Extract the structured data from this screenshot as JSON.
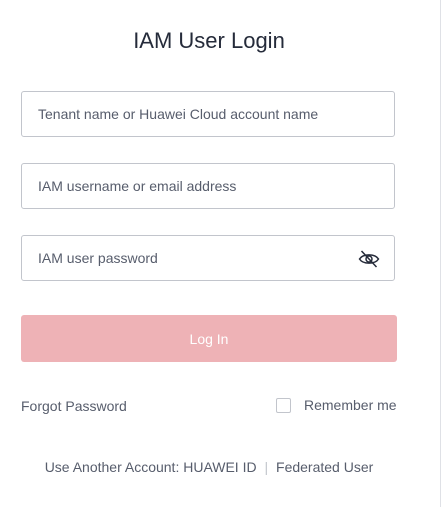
{
  "form": {
    "title": "IAM User Login",
    "tenant_field": {
      "value": "",
      "placeholder": "Tenant name or Huawei Cloud account name"
    },
    "username_field": {
      "value": "",
      "placeholder": "IAM username or email address"
    },
    "password_field": {
      "value": "",
      "placeholder": "IAM user password",
      "toggle_icon": "eye-hidden-icon"
    },
    "login_button": {
      "label": "Log In",
      "state": "disabled",
      "color": "#eeb2b6"
    },
    "forgot_password": "Forgot Password",
    "remember_me": {
      "label": "Remember me",
      "checked": false
    }
  },
  "footer": {
    "prefix": "Use Another Account:",
    "huawei_id": "HUAWEI ID",
    "separator": "|",
    "federated_user": "Federated User"
  }
}
